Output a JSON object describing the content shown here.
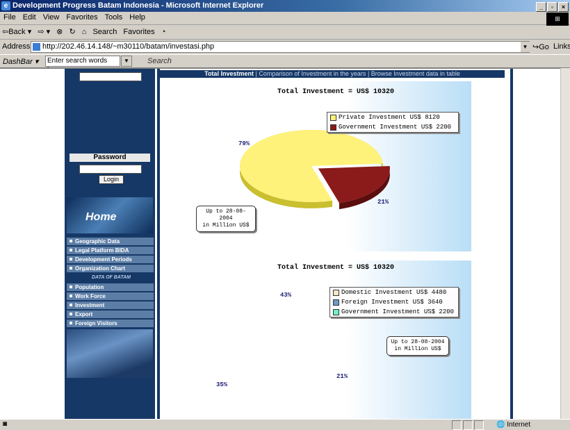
{
  "window": {
    "title": "Development Progress Batam Indonesia - Microsoft Internet Explorer",
    "controls": [
      "_",
      "▫",
      "×"
    ]
  },
  "menu": [
    "File",
    "Edit",
    "View",
    "Favorites",
    "Tools",
    "Help"
  ],
  "toolbar": {
    "back": "⇦Back ▾",
    "forward": "⇨ ▾",
    "stop": "⊗",
    "refresh": "↻",
    "home": "⌂",
    "search": "Search",
    "favorites": "Favorites",
    "history": "◔"
  },
  "address": {
    "label": "Address",
    "url": "http://202.46.14.148/~m30110/batam/investasi.php",
    "go": "Go",
    "links": "Links"
  },
  "dashbar": {
    "label": "DashBar ▾",
    "search_placeholder": "Enter search words here",
    "search_button": "Search"
  },
  "sidebar": {
    "password_label": "Password",
    "login_button": "Login",
    "home_label": "Home",
    "nav_items_a": [
      "Geographic Data",
      "Legal Platform BIDA",
      "Development Periods",
      "Organization Chart"
    ],
    "sub_label": "DATA OF BATAM",
    "nav_items_b": [
      "Population",
      "Work Force",
      "Investment",
      "Export",
      "Foreign Visitors"
    ]
  },
  "tabs": {
    "active": "Total Investment",
    "sep": "|",
    "items": [
      "Comparison of Investment in the years",
      "Browse Investment data in table"
    ]
  },
  "charts": {
    "top": {
      "title": "Total Investment = US$ 10320",
      "note_line1": "Up to 28-08-2004",
      "note_line2": "in Million US$",
      "pct_labels": [
        "79%",
        "21%"
      ]
    },
    "bottom": {
      "title": "Total Investment = US$ 10320",
      "note_line1": "Up to 28-08-2004",
      "note_line2": "in Million US$",
      "pct_labels": [
        "43%",
        "35%",
        "21%"
      ]
    }
  },
  "chart_data": [
    {
      "type": "pie",
      "title": "Total Investment = US$ 10320",
      "categories": [
        "Private Investment US$ 8120",
        "Government Investment US$ 2200"
      ],
      "values": [
        8120,
        2200
      ],
      "percent_labels": [
        "79%",
        "21%"
      ],
      "colors": [
        "#fff27a",
        "#8b1a1a"
      ],
      "side_colors": [
        "#c9bf2f",
        "#5a0e0e"
      ],
      "legend": "top-right"
    },
    {
      "type": "pie",
      "title": "Total Investment = US$ 10320",
      "categories": [
        "Domestic Investment US$ 4480",
        "Foreign Investment US$ 3640",
        "Government Investment US$ 2200"
      ],
      "values": [
        4480,
        3640,
        2200
      ],
      "percent_labels": [
        "43%",
        "35%",
        "21%"
      ],
      "colors": [
        "#fbe5c8",
        "#6e9ac2",
        "#6ff0c8"
      ],
      "side_colors": [
        "#b9956b",
        "#2d5b86",
        "#2fa888"
      ],
      "legend": "top-right"
    }
  ],
  "status": {
    "zone": "Internet"
  }
}
